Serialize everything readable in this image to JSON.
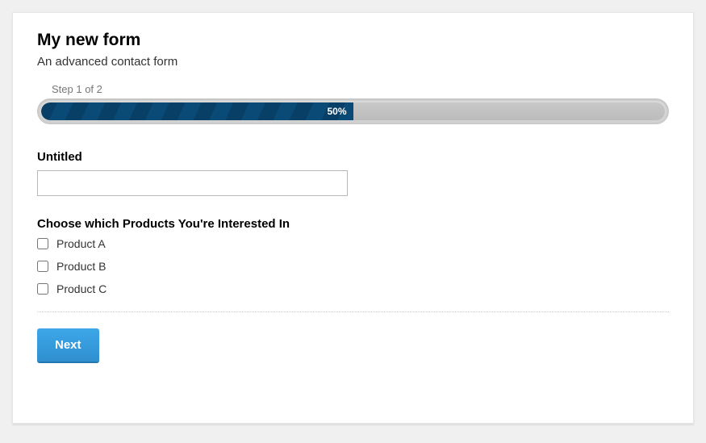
{
  "form": {
    "title": "My new form",
    "subtitle": "An advanced contact form",
    "progress": {
      "step_label": "Step 1 of 2",
      "percent_text": "50%",
      "percent_width": "50%"
    },
    "fields": {
      "untitled": {
        "label": "Untitled",
        "value": ""
      },
      "products": {
        "label": "Choose which Products You're Interested In",
        "options": [
          {
            "label": "Product A"
          },
          {
            "label": "Product B"
          },
          {
            "label": "Product C"
          }
        ]
      }
    },
    "next_button": "Next"
  }
}
